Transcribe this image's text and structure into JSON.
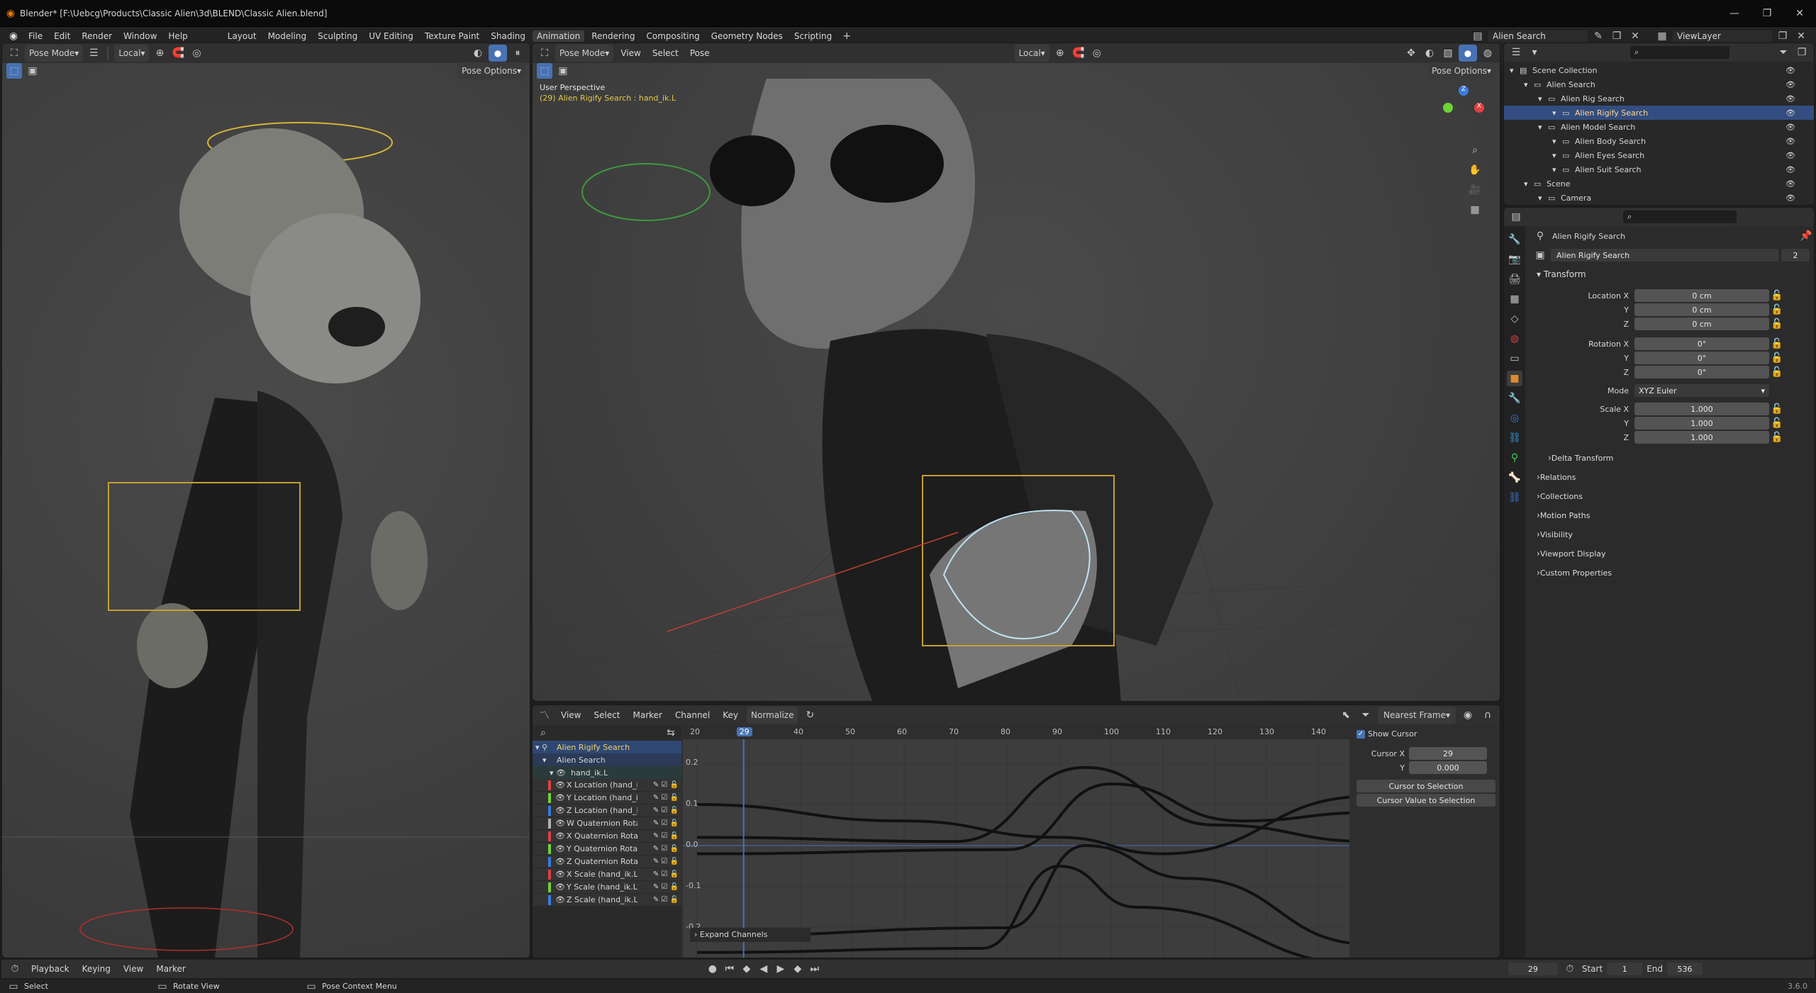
{
  "window": {
    "title": "Blender* [F:\\Uebcg\\Products\\Classic Alien\\3d\\BLEND\\Classic Alien.blend]"
  },
  "menu": {
    "items": [
      "File",
      "Edit",
      "Render",
      "Window",
      "Help"
    ]
  },
  "workspaces": {
    "tabs": [
      "Layout",
      "Modeling",
      "Sculpting",
      "UV Editing",
      "Texture Paint",
      "Shading",
      "Animation",
      "Rendering",
      "Compositing",
      "Geometry Nodes",
      "Scripting"
    ],
    "active": "Animation"
  },
  "topright": {
    "scene": "Alien Search",
    "view_layer": "ViewLayer"
  },
  "left_viewport": {
    "mode": "Pose Mode",
    "orientation": "Local",
    "options": "Pose Options"
  },
  "main_viewport": {
    "mode": "Pose Mode",
    "menus": [
      "View",
      "Select",
      "Pose"
    ],
    "orientation": "Local",
    "options": "Pose Options",
    "perspective": "User Perspective",
    "active_info": "(29) Alien Rigify Search : hand_ik.L"
  },
  "outliner": {
    "search_placeholder": "",
    "items": [
      {
        "label": "Scene Collection",
        "level": 0
      },
      {
        "label": "Alien Search",
        "level": 1
      },
      {
        "label": "Alien Rig Search",
        "level": 2
      },
      {
        "label": "Alien Rigify Search",
        "level": 3,
        "selected": true
      },
      {
        "label": "Alien Model Search",
        "level": 2
      },
      {
        "label": "Alien Body Search",
        "level": 3
      },
      {
        "label": "Alien Eyes Search",
        "level": 3
      },
      {
        "label": "Alien Suit Search",
        "level": 3
      },
      {
        "label": "Scene",
        "level": 1
      },
      {
        "label": "Camera",
        "level": 2
      }
    ]
  },
  "properties": {
    "object_title": "Alien Rigify Search",
    "datablock": "Alien Rigify Search",
    "users": "2",
    "transform_label": "Transform",
    "location_label": "Location X",
    "location": [
      "0 cm",
      "0 cm",
      "0 cm"
    ],
    "rotation_label": "Rotation X",
    "rotation": [
      "0°",
      "0°",
      "0°"
    ],
    "mode_label": "Mode",
    "mode": "XYZ Euler",
    "scale_label": "Scale X",
    "scale": [
      "1.000",
      "1.000",
      "1.000"
    ],
    "axis_y": "Y",
    "axis_z": "Z",
    "sections": [
      "Delta Transform",
      "Relations",
      "Collections",
      "Motion Paths",
      "Visibility",
      "Viewport Display",
      "Custom Properties"
    ]
  },
  "graph_editor": {
    "menus": [
      "View",
      "Select",
      "Marker",
      "Channel",
      "Key"
    ],
    "normalize": "Normalize",
    "snap": "Nearest Frame",
    "frame_ticks": [
      "20",
      "29",
      "40",
      "50",
      "60",
      "70",
      "80",
      "90",
      "100",
      "110",
      "120",
      "130",
      "140"
    ],
    "current_frame": 29,
    "y_ticks": [
      "0.2",
      "0.1",
      "0.0",
      "-0.1",
      "-0.2"
    ],
    "channels_root": "Alien Rigify Search",
    "channels_action": "Alien Search",
    "channels_group": "hand_ik.L",
    "channels": [
      {
        "label": "X Location (hand_i",
        "color": "#e04040"
      },
      {
        "label": "Y Location (hand_i",
        "color": "#6ed236"
      },
      {
        "label": "Z Location (hand_i",
        "color": "#3a7be0"
      },
      {
        "label": "W Quaternion Rota",
        "color": "#b0b0b0"
      },
      {
        "label": "X Quaternion Rotat",
        "color": "#e04040"
      },
      {
        "label": "Y Quaternion Rotat",
        "color": "#6ed236"
      },
      {
        "label": "Z Quaternion Rotat",
        "color": "#3a7be0"
      },
      {
        "label": "X Scale (hand_ik.L",
        "color": "#e04040"
      },
      {
        "label": "Y Scale (hand_ik.L",
        "color": "#6ed236"
      },
      {
        "label": "Z Scale (hand_ik.L",
        "color": "#3a7be0"
      }
    ],
    "expand": "Expand Channels",
    "sidebar": {
      "show_cursor": "Show Cursor",
      "cursor_x_label": "Cursor X",
      "cursor_x": "29",
      "y_label": "Y",
      "cursor_y": "0.000",
      "btn1": "Cursor to Selection",
      "btn2": "Cursor Value to Selection"
    }
  },
  "timeline": {
    "menus": [
      "Playback",
      "Keying",
      "View",
      "Marker"
    ],
    "frame": "29",
    "start_label": "Start",
    "start": "1",
    "end_label": "End",
    "end": "536"
  },
  "statusbar": {
    "items": [
      "Select",
      "Rotate View",
      "Pose Context Menu"
    ],
    "version": "3.6.0"
  }
}
